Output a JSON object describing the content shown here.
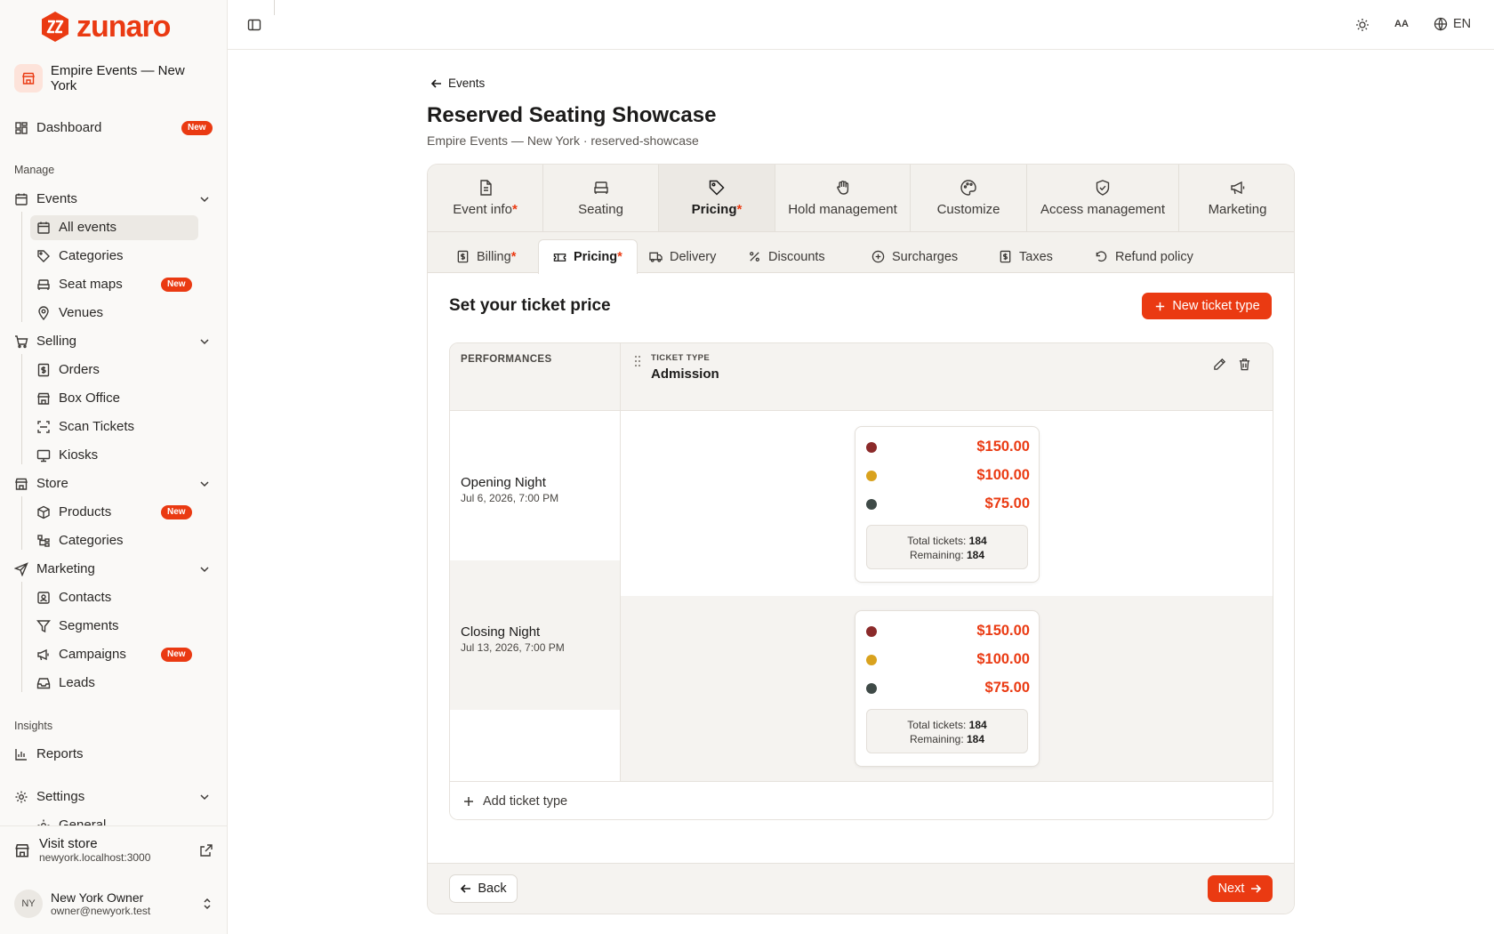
{
  "brand": {
    "name": "zunaro",
    "color": "#ea3a12"
  },
  "org": {
    "name": "Empire Events — New York"
  },
  "sidebar": {
    "dashboard": {
      "label": "Dashboard",
      "badge": "New"
    },
    "manage_label": "Manage",
    "events": {
      "label": "Events",
      "items": [
        {
          "label": "All events"
        },
        {
          "label": "Categories"
        },
        {
          "label": "Seat maps",
          "badge": "New"
        },
        {
          "label": "Venues"
        }
      ]
    },
    "selling": {
      "label": "Selling",
      "items": [
        {
          "label": "Orders"
        },
        {
          "label": "Box Office"
        },
        {
          "label": "Scan Tickets"
        },
        {
          "label": "Kiosks"
        }
      ]
    },
    "store": {
      "label": "Store",
      "items": [
        {
          "label": "Products",
          "badge": "New"
        },
        {
          "label": "Categories"
        }
      ]
    },
    "marketing": {
      "label": "Marketing",
      "items": [
        {
          "label": "Contacts"
        },
        {
          "label": "Segments"
        },
        {
          "label": "Campaigns",
          "badge": "New"
        },
        {
          "label": "Leads"
        }
      ]
    },
    "insights_label": "Insights",
    "reports": {
      "label": "Reports"
    },
    "settings": {
      "label": "Settings",
      "first_child": "General"
    },
    "visit_store": {
      "label": "Visit store",
      "url": "newyork.localhost:3000"
    },
    "user": {
      "initials": "NY",
      "name": "New York Owner",
      "email": "owner@newyork.test"
    }
  },
  "topbar": {
    "text_size_label": "AA",
    "language": "EN"
  },
  "page": {
    "back_label": "Events",
    "title": "Reserved Seating Showcase",
    "subtitle": "Empire Events — New York · reserved-showcase"
  },
  "steps": [
    {
      "label": "Event info",
      "required": "*"
    },
    {
      "label": "Seating"
    },
    {
      "label": "Pricing",
      "required": "*"
    },
    {
      "label": "Hold management"
    },
    {
      "label": "Customize"
    },
    {
      "label": "Access management"
    },
    {
      "label": "Marketing"
    }
  ],
  "subtabs": [
    {
      "label": "Billing",
      "required": "*"
    },
    {
      "label": "Pricing",
      "required": "*"
    },
    {
      "label": "Delivery"
    },
    {
      "label": "Discounts"
    },
    {
      "label": "Surcharges"
    },
    {
      "label": "Taxes"
    },
    {
      "label": "Refund policy"
    }
  ],
  "pricing": {
    "section_title": "Set your ticket price",
    "new_ticket_type_label": "New ticket type",
    "performances_header": "PERFORMANCES",
    "ticket_type_header": "TICKET TYPE",
    "ticket_type_name": "Admission",
    "totals_label": "Total tickets:",
    "remaining_label": "Remaining:",
    "tier_colors": [
      "#8b2a2a",
      "#d9a21e",
      "#3f4a47"
    ],
    "performances": [
      {
        "name": "Opening Night",
        "date": "Jul 6, 2026, 7:00 PM",
        "prices": [
          "$150.00",
          "$100.00",
          "$75.00"
        ],
        "total": "184",
        "remaining": "184"
      },
      {
        "name": "Closing Night",
        "date": "Jul 13, 2026, 7:00 PM",
        "prices": [
          "$150.00",
          "$100.00",
          "$75.00"
        ],
        "total": "184",
        "remaining": "184"
      }
    ],
    "add_ticket_type_label": "Add ticket type"
  },
  "footer": {
    "back_label": "Back",
    "next_label": "Next"
  }
}
